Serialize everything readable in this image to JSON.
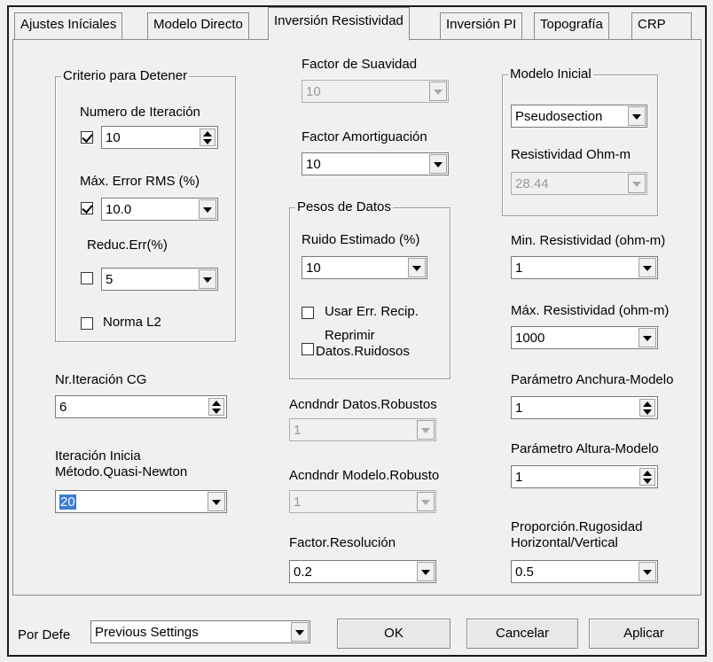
{
  "tabs": [
    "Ajustes Iníciales",
    "Modelo Directo",
    "Inversión Resistividad",
    "Inversión PI",
    "Topografía",
    "CRP"
  ],
  "stop_criteria": {
    "title": "Criterio para Detener",
    "iter_label": "Numero de Iteración",
    "iter_value": "10",
    "rms_label": "Máx. Error RMS (%)",
    "rms_value": "10.0",
    "reduc_label": "Reduc.Err(%)",
    "reduc_value": "5",
    "l2_label": "Norma L2"
  },
  "cg": {
    "label": "Nr.Iteración CG",
    "value": "6"
  },
  "qn": {
    "label_line1": "Iteración Inicia",
    "label_line2": "Método.Quasi-Newton",
    "value": "20"
  },
  "smooth": {
    "label": "Factor de Suavidad",
    "value": "10"
  },
  "damping": {
    "label": "Factor Amortiguación",
    "value": "10"
  },
  "weights": {
    "title": "Pesos de Datos",
    "noise_label": "Ruido Estimado (%)",
    "noise_value": "10",
    "recip_label": "Usar Err. Recip.",
    "noisy_label_line1": "Reprimir",
    "noisy_label_line2": "Datos.Ruidosos"
  },
  "robust_data": {
    "label": "Acndndr Datos.Robustos",
    "value": "1"
  },
  "robust_model": {
    "label": "Acndndr Modelo.Robusto",
    "value": "1"
  },
  "resolution": {
    "label": "Factor.Resolución",
    "value": "0.2"
  },
  "initial_model": {
    "title": "Modelo Inicial",
    "type_value": "Pseudosection",
    "res_label": "Resistividad Ohm-m",
    "res_value": "28.44"
  },
  "min_res": {
    "label": "Min. Resistividad (ohm-m)",
    "value": "1"
  },
  "max_res": {
    "label": "Máx. Resistividad (ohm-m)",
    "value": "1000"
  },
  "width_param": {
    "label": "Parámetro Anchura-Modelo",
    "value": "1"
  },
  "height_param": {
    "label": "Parámetro Altura-Modelo",
    "value": "1"
  },
  "roughness": {
    "label_line1": "Proporción.Rugosidad",
    "label_line2": "Horizontal/Vertical",
    "value": "0.5"
  },
  "footer": {
    "default_label": "Por Defe",
    "preset_value": "Previous Settings",
    "ok": "OK",
    "cancel": "Cancelar",
    "apply": "Aplicar"
  }
}
